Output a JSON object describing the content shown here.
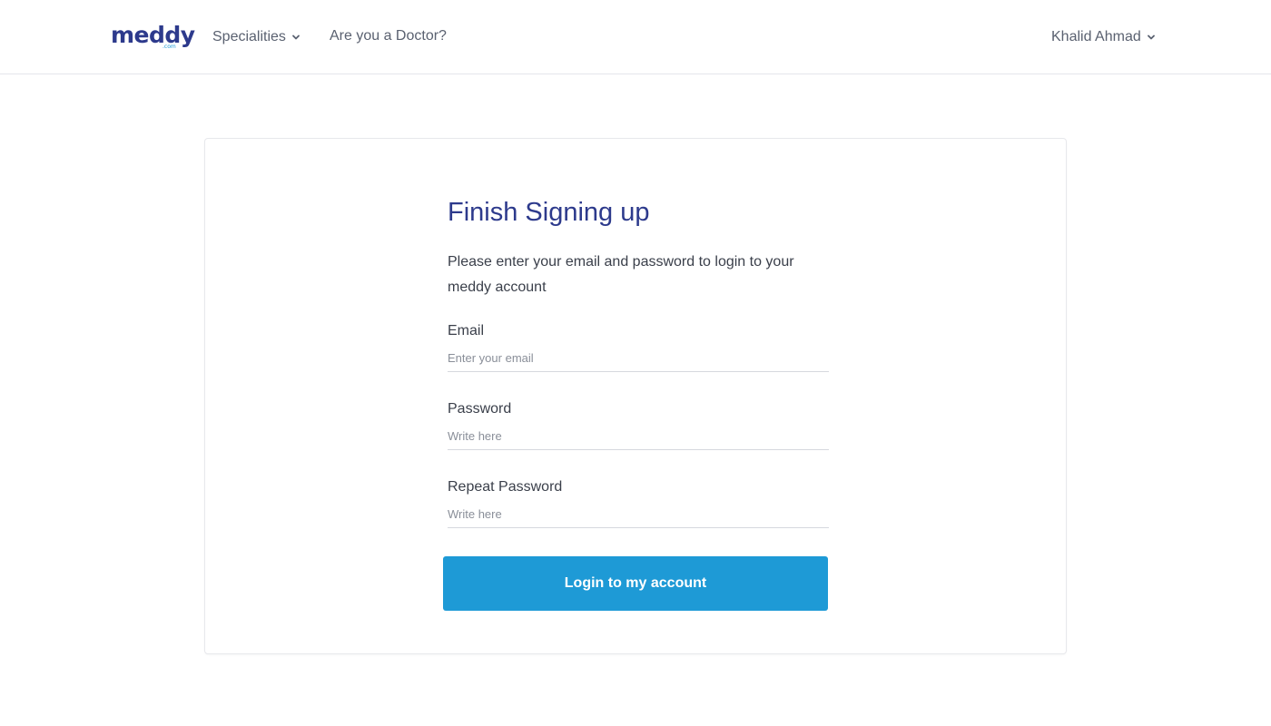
{
  "header": {
    "logo": {
      "main": "meddy",
      "sub": ".com"
    },
    "nav": {
      "specialities": "Specialities",
      "doctor": "Are you a Doctor?",
      "user": "Khalid Ahmad"
    }
  },
  "form": {
    "title": "Finish Signing up",
    "subtitle": "Please enter your email and password to login to your meddy account",
    "email": {
      "label": "Email",
      "placeholder": "Enter your email",
      "value": ""
    },
    "password": {
      "label": "Password",
      "placeholder": "Write here",
      "value": ""
    },
    "repeat_password": {
      "label": "Repeat Password",
      "placeholder": "Write here",
      "value": ""
    },
    "submit_label": "Login to my account"
  },
  "colors": {
    "brand_dark": "#2d3a8c",
    "brand_accent": "#1e9ad6",
    "nav_text": "#5a6170"
  },
  "icons": {
    "chevron": "chevron-down-icon"
  }
}
